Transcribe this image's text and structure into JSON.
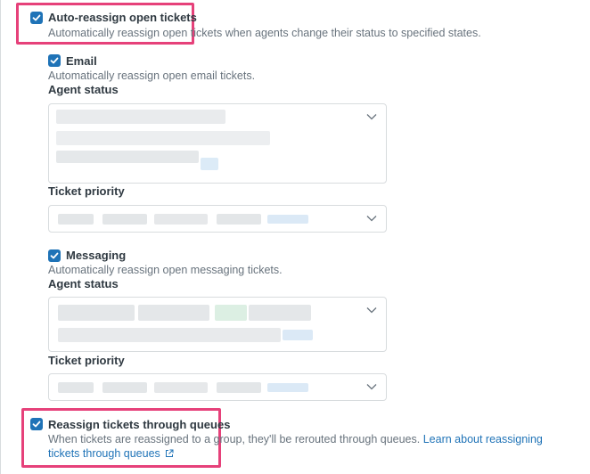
{
  "auto_reassign": {
    "label": "Auto-reassign open tickets",
    "hint": "Automatically reassign open tickets when agents change their status to specified states.",
    "checked": true
  },
  "email": {
    "label": "Email",
    "hint": "Automatically reassign open email tickets.",
    "checked": true,
    "agent_status_label": "Agent status",
    "ticket_priority_label": "Ticket priority"
  },
  "messaging": {
    "label": "Messaging",
    "hint": "Automatically reassign open messaging tickets.",
    "checked": true,
    "agent_status_label": "Agent status",
    "ticket_priority_label": "Ticket priority"
  },
  "queues": {
    "label": "Reassign tickets through queues",
    "hint": "When tickets are reassigned to a group, they'll be rerouted through queues.",
    "link_line1": "Learn about reassigning",
    "link_line2": "tickets through queues",
    "checked": true
  },
  "colors": {
    "accent": "#1f73b7",
    "highlight": "#e6417a"
  },
  "icons": [
    "checkmark-icon",
    "chevron-down-icon",
    "external-link-icon"
  ]
}
